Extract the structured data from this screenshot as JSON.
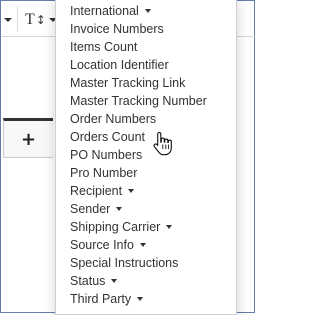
{
  "toolbar": {
    "text_button_label": "T",
    "sort_glyph": "↕",
    "left_button_icon": "caret-down-icon"
  },
  "tab": {
    "label": "+"
  },
  "menu": {
    "items": [
      {
        "label": "International",
        "has_submenu": true
      },
      {
        "label": "Invoice Numbers",
        "has_submenu": false
      },
      {
        "label": "Items Count",
        "has_submenu": false
      },
      {
        "label": "Location Identifier",
        "has_submenu": false
      },
      {
        "label": "Master Tracking Link",
        "has_submenu": false
      },
      {
        "label": "Master Tracking Number",
        "has_submenu": false
      },
      {
        "label": "Order Numbers",
        "has_submenu": false
      },
      {
        "label": "Orders Count",
        "has_submenu": false
      },
      {
        "label": "PO Numbers",
        "has_submenu": false
      },
      {
        "label": "Pro Number",
        "has_submenu": false
      },
      {
        "label": "Recipient",
        "has_submenu": true
      },
      {
        "label": "Sender",
        "has_submenu": true
      },
      {
        "label": "Shipping Carrier",
        "has_submenu": true
      },
      {
        "label": "Source Info",
        "has_submenu": true
      },
      {
        "label": "Special Instructions",
        "has_submenu": false
      },
      {
        "label": "Status",
        "has_submenu": true
      },
      {
        "label": "Third Party",
        "has_submenu": true
      }
    ]
  },
  "cursor_icon": "hand-pointer-icon",
  "colors": {
    "frame_border": "#5f7fa8",
    "text": "#333333",
    "tab_border_top": "#333333"
  }
}
